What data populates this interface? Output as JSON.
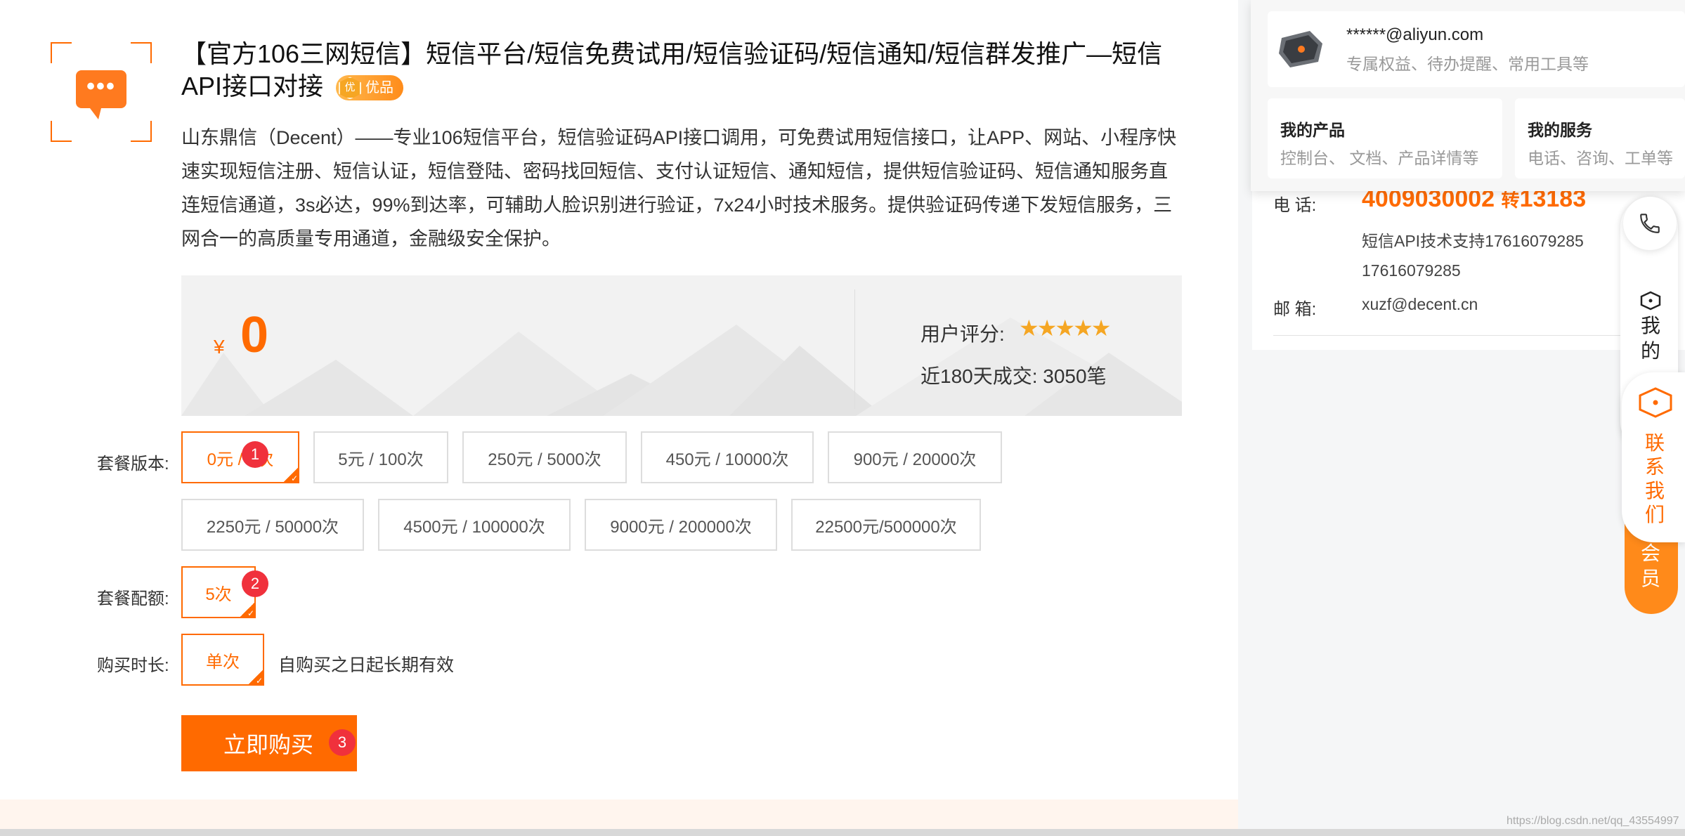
{
  "product": {
    "title": "【官方106三网短信】短信平台/短信免费试用/短信验证码/短信通知/短信群发推广—短信API接口对接",
    "badge": "优品",
    "badge_icon": "优",
    "description": "山东鼎信（Decent）——专业106短信平台，短信验证码API接口调用，可免费试用短信接口，让APP、网站、小程序快速实现短信注册、短信认证，短信登陆、密码找回短信、支付认证短信、通知短信，提供短信验证码、短信通知服务直连短信通道，3s必达，99%到达率，可辅助人脸识别进行验证，7x24小时技术服务。提供验证码传递下发短信服务，三网合一的高质量专用通道，金融级安全保护。"
  },
  "price": {
    "currency": "¥",
    "value": "0"
  },
  "stats": {
    "rating_label": "用户评分:",
    "rating_stars": 5,
    "stars_text": "★★★★★",
    "deals": "近180天成交: 3050笔"
  },
  "package_version": {
    "label": "套餐版本:",
    "options": [
      "0元 / 5次",
      "5元 / 100次",
      "250元 / 5000次",
      "450元 / 10000次",
      "900元 / 20000次",
      "2250元 / 50000次",
      "4500元 / 100000次",
      "9000元 / 200000次",
      "22500元/500000次"
    ],
    "selected": 0
  },
  "package_quota": {
    "label": "套餐配额:",
    "options": [
      "5次"
    ]
  },
  "purchase_duration": {
    "label": "购买时长:",
    "options": [
      "单次"
    ],
    "note": "自购买之日起长期有效"
  },
  "buy_button": "立即购买",
  "step_badges": [
    "1",
    "2",
    "3"
  ],
  "contact": {
    "phone_label": "电 话:",
    "phone_main": "4009030002",
    "phone_ext_prefix": "转",
    "phone_ext": "13183",
    "support_text": "短信API技术支持17616079285",
    "support_phone": "17616079285",
    "email_label": "邮 箱:",
    "email": "xuzf@decent.cn"
  },
  "account": {
    "email": "******@aliyun.com",
    "subtitle": "专属权益、待办提醒、常用工具等",
    "products_title": "我的产品",
    "products_sub": "控制台、 文档、产品详情等",
    "services_title": "我的服务",
    "services_sub": "电话、咨询、工单等"
  },
  "toolbar": {
    "my_label": "我的",
    "member_label": "会员",
    "contact_label": "联系我们"
  },
  "watermark": "https://blog.csdn.net/qq_43554997",
  "colors": {
    "accent": "#ff6a00",
    "badge_red": "#f0313c"
  }
}
